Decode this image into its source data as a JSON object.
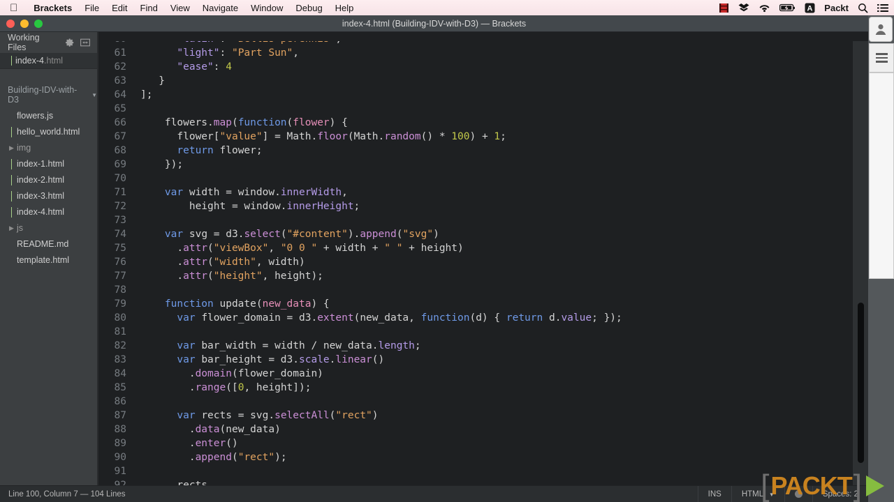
{
  "menubar": {
    "apple_icon": "apple-logo-icon",
    "items": [
      "Brackets",
      "File",
      "Edit",
      "Find",
      "View",
      "Navigate",
      "Window",
      "Debug",
      "Help"
    ],
    "status_items": [
      {
        "name": "film-strip-icon",
        "label": ""
      },
      {
        "name": "dropbox-icon",
        "label": ""
      },
      {
        "name": "wifi-icon",
        "label": ""
      },
      {
        "name": "battery-charging-icon",
        "label": ""
      },
      {
        "name": "input-source-a-icon",
        "label": "A"
      },
      {
        "name": "user-account",
        "label": "Packt"
      },
      {
        "name": "spotlight-search-icon",
        "label": ""
      },
      {
        "name": "notification-center-icon",
        "label": ""
      }
    ]
  },
  "window": {
    "title": "index-4.html (Building-IDV-with-D3) — Brackets"
  },
  "sidebar": {
    "working_files_label": "Working Files",
    "working_files": [
      {
        "name": "index-4",
        "ext": ".html",
        "active": true
      }
    ],
    "project_label": "Building-IDV-with-D3",
    "tree": [
      {
        "name": "flowers",
        "ext": ".js",
        "type": "file"
      },
      {
        "name": "hello_world",
        "ext": ".html",
        "type": "file"
      },
      {
        "name": "img",
        "ext": "",
        "type": "folder"
      },
      {
        "name": "index-1",
        "ext": ".html",
        "type": "file"
      },
      {
        "name": "index-2",
        "ext": ".html",
        "type": "file"
      },
      {
        "name": "index-3",
        "ext": ".html",
        "type": "file"
      },
      {
        "name": "index-4",
        "ext": ".html",
        "type": "file"
      },
      {
        "name": "js",
        "ext": "",
        "type": "folder"
      },
      {
        "name": "README",
        "ext": ".md",
        "type": "file"
      },
      {
        "name": "template",
        "ext": ".html",
        "type": "file"
      }
    ]
  },
  "editor": {
    "first_line_number": 60,
    "lines": [
      {
        "n": 60,
        "tokens": [
          {
            "t": "      ",
            "c": "pl"
          },
          {
            "t": "\"latin\"",
            "c": "prop"
          },
          {
            "t": ": ",
            "c": "pl"
          },
          {
            "t": "\"Bellis perennis\"",
            "c": "str"
          },
          {
            "t": ",",
            "c": "pl"
          }
        ]
      },
      {
        "n": 61,
        "tokens": [
          {
            "t": "      ",
            "c": "pl"
          },
          {
            "t": "\"light\"",
            "c": "prop"
          },
          {
            "t": ": ",
            "c": "pl"
          },
          {
            "t": "\"Part Sun\"",
            "c": "str"
          },
          {
            "t": ",",
            "c": "pl"
          }
        ]
      },
      {
        "n": 62,
        "tokens": [
          {
            "t": "      ",
            "c": "pl"
          },
          {
            "t": "\"ease\"",
            "c": "prop"
          },
          {
            "t": ": ",
            "c": "pl"
          },
          {
            "t": "4",
            "c": "num"
          }
        ]
      },
      {
        "n": 63,
        "tokens": [
          {
            "t": "   }",
            "c": "pl"
          }
        ]
      },
      {
        "n": 64,
        "tokens": [
          {
            "t": "];",
            "c": "pl"
          }
        ]
      },
      {
        "n": 65,
        "tokens": []
      },
      {
        "n": 66,
        "tokens": [
          {
            "t": "    flowers.",
            "c": "pl"
          },
          {
            "t": "map",
            "c": "fn"
          },
          {
            "t": "(",
            "c": "pl"
          },
          {
            "t": "function",
            "c": "kw"
          },
          {
            "t": "(",
            "c": "pl"
          },
          {
            "t": "flower",
            "c": "def"
          },
          {
            "t": ") {",
            "c": "pl"
          }
        ]
      },
      {
        "n": 67,
        "tokens": [
          {
            "t": "      flower[",
            "c": "pl"
          },
          {
            "t": "\"value\"",
            "c": "str"
          },
          {
            "t": "] = Math.",
            "c": "pl"
          },
          {
            "t": "floor",
            "c": "fn"
          },
          {
            "t": "(Math.",
            "c": "pl"
          },
          {
            "t": "random",
            "c": "fn"
          },
          {
            "t": "() * ",
            "c": "pl"
          },
          {
            "t": "100",
            "c": "num"
          },
          {
            "t": ") + ",
            "c": "pl"
          },
          {
            "t": "1",
            "c": "num"
          },
          {
            "t": ";",
            "c": "pl"
          }
        ]
      },
      {
        "n": 68,
        "tokens": [
          {
            "t": "      ",
            "c": "pl"
          },
          {
            "t": "return",
            "c": "kw"
          },
          {
            "t": " flower;",
            "c": "pl"
          }
        ]
      },
      {
        "n": 69,
        "tokens": [
          {
            "t": "    });",
            "c": "pl"
          }
        ]
      },
      {
        "n": 70,
        "tokens": []
      },
      {
        "n": 71,
        "tokens": [
          {
            "t": "    ",
            "c": "pl"
          },
          {
            "t": "var",
            "c": "kw"
          },
          {
            "t": " width = window.",
            "c": "pl"
          },
          {
            "t": "innerWidth",
            "c": "prop"
          },
          {
            "t": ",",
            "c": "pl"
          }
        ]
      },
      {
        "n": 72,
        "tokens": [
          {
            "t": "        height = window.",
            "c": "pl"
          },
          {
            "t": "innerHeight",
            "c": "prop"
          },
          {
            "t": ";",
            "c": "pl"
          }
        ]
      },
      {
        "n": 73,
        "tokens": []
      },
      {
        "n": 74,
        "tokens": [
          {
            "t": "    ",
            "c": "pl"
          },
          {
            "t": "var",
            "c": "kw"
          },
          {
            "t": " svg = d3.",
            "c": "pl"
          },
          {
            "t": "select",
            "c": "fn"
          },
          {
            "t": "(",
            "c": "pl"
          },
          {
            "t": "\"#content\"",
            "c": "str"
          },
          {
            "t": ").",
            "c": "pl"
          },
          {
            "t": "append",
            "c": "fn"
          },
          {
            "t": "(",
            "c": "pl"
          },
          {
            "t": "\"svg\"",
            "c": "str"
          },
          {
            "t": ")",
            "c": "pl"
          }
        ]
      },
      {
        "n": 75,
        "tokens": [
          {
            "t": "      .",
            "c": "pl"
          },
          {
            "t": "attr",
            "c": "fn"
          },
          {
            "t": "(",
            "c": "pl"
          },
          {
            "t": "\"viewBox\"",
            "c": "str"
          },
          {
            "t": ", ",
            "c": "pl"
          },
          {
            "t": "\"0 0 \"",
            "c": "str"
          },
          {
            "t": " + width + ",
            "c": "pl"
          },
          {
            "t": "\" \"",
            "c": "str"
          },
          {
            "t": " + height)",
            "c": "pl"
          }
        ]
      },
      {
        "n": 76,
        "tokens": [
          {
            "t": "      .",
            "c": "pl"
          },
          {
            "t": "attr",
            "c": "fn"
          },
          {
            "t": "(",
            "c": "pl"
          },
          {
            "t": "\"width\"",
            "c": "str"
          },
          {
            "t": ", width)",
            "c": "pl"
          }
        ]
      },
      {
        "n": 77,
        "tokens": [
          {
            "t": "      .",
            "c": "pl"
          },
          {
            "t": "attr",
            "c": "fn"
          },
          {
            "t": "(",
            "c": "pl"
          },
          {
            "t": "\"height\"",
            "c": "str"
          },
          {
            "t": ", height);",
            "c": "pl"
          }
        ]
      },
      {
        "n": 78,
        "tokens": []
      },
      {
        "n": 79,
        "tokens": [
          {
            "t": "    ",
            "c": "pl"
          },
          {
            "t": "function",
            "c": "kw"
          },
          {
            "t": " update(",
            "c": "pl"
          },
          {
            "t": "new_data",
            "c": "def"
          },
          {
            "t": ") {",
            "c": "pl"
          }
        ]
      },
      {
        "n": 80,
        "tokens": [
          {
            "t": "      ",
            "c": "pl"
          },
          {
            "t": "var",
            "c": "kw"
          },
          {
            "t": " flower_domain = d3.",
            "c": "pl"
          },
          {
            "t": "extent",
            "c": "fn"
          },
          {
            "t": "(new_data, ",
            "c": "pl"
          },
          {
            "t": "function",
            "c": "kw"
          },
          {
            "t": "(d) { ",
            "c": "pl"
          },
          {
            "t": "return",
            "c": "kw"
          },
          {
            "t": " d.",
            "c": "pl"
          },
          {
            "t": "value",
            "c": "prop"
          },
          {
            "t": "; });",
            "c": "pl"
          }
        ]
      },
      {
        "n": 81,
        "tokens": []
      },
      {
        "n": 82,
        "tokens": [
          {
            "t": "      ",
            "c": "pl"
          },
          {
            "t": "var",
            "c": "kw"
          },
          {
            "t": " bar_width = width / new_data.",
            "c": "pl"
          },
          {
            "t": "length",
            "c": "prop"
          },
          {
            "t": ";",
            "c": "pl"
          }
        ]
      },
      {
        "n": 83,
        "tokens": [
          {
            "t": "      ",
            "c": "pl"
          },
          {
            "t": "var",
            "c": "kw"
          },
          {
            "t": " bar_height = d3.",
            "c": "pl"
          },
          {
            "t": "scale",
            "c": "prop"
          },
          {
            "t": ".",
            "c": "pl"
          },
          {
            "t": "linear",
            "c": "fn"
          },
          {
            "t": "()",
            "c": "pl"
          }
        ]
      },
      {
        "n": 84,
        "tokens": [
          {
            "t": "        .",
            "c": "pl"
          },
          {
            "t": "domain",
            "c": "fn"
          },
          {
            "t": "(flower_domain)",
            "c": "pl"
          }
        ]
      },
      {
        "n": 85,
        "tokens": [
          {
            "t": "        .",
            "c": "pl"
          },
          {
            "t": "range",
            "c": "fn"
          },
          {
            "t": "([",
            "c": "pl"
          },
          {
            "t": "0",
            "c": "num"
          },
          {
            "t": ", height]);",
            "c": "pl"
          }
        ]
      },
      {
        "n": 86,
        "tokens": []
      },
      {
        "n": 87,
        "tokens": [
          {
            "t": "      ",
            "c": "pl"
          },
          {
            "t": "var",
            "c": "kw"
          },
          {
            "t": " rects = svg.",
            "c": "pl"
          },
          {
            "t": "selectAll",
            "c": "fn"
          },
          {
            "t": "(",
            "c": "pl"
          },
          {
            "t": "\"rect\"",
            "c": "str"
          },
          {
            "t": ")",
            "c": "pl"
          }
        ]
      },
      {
        "n": 88,
        "tokens": [
          {
            "t": "        .",
            "c": "pl"
          },
          {
            "t": "data",
            "c": "fn"
          },
          {
            "t": "(new_data)",
            "c": "pl"
          }
        ]
      },
      {
        "n": 89,
        "tokens": [
          {
            "t": "        .",
            "c": "pl"
          },
          {
            "t": "enter",
            "c": "fn"
          },
          {
            "t": "()",
            "c": "pl"
          }
        ]
      },
      {
        "n": 90,
        "tokens": [
          {
            "t": "        .",
            "c": "pl"
          },
          {
            "t": "append",
            "c": "fn"
          },
          {
            "t": "(",
            "c": "pl"
          },
          {
            "t": "\"rect\"",
            "c": "str"
          },
          {
            "t": ");",
            "c": "pl"
          }
        ]
      },
      {
        "n": 91,
        "tokens": []
      },
      {
        "n": 92,
        "tokens": [
          {
            "t": "      rects",
            "c": "pl"
          }
        ]
      }
    ]
  },
  "statusbar": {
    "cursor_info": "Line 100, Column 7 — 104 Lines",
    "insert_mode": "INS",
    "language": "HTML",
    "indent_label": "Spaces: 2"
  },
  "right_toolbar": {
    "icons": [
      "live-preview-zigzag-icon",
      "extension-manager-icon",
      "gift-box-icon",
      "git-icon",
      "upload-layers-icon"
    ]
  },
  "watermark": {
    "bracket_left": "[",
    "text": "PACKT",
    "bracket_right": "]",
    "play_icon": "play-triangle-icon"
  },
  "colors": {
    "menubar_bg": "#f7e3e7",
    "editor_bg": "#1e2022",
    "sidebar_bg": "#3c3f41",
    "accent_green": "#86bc40",
    "packt_orange": "#c8821f"
  }
}
